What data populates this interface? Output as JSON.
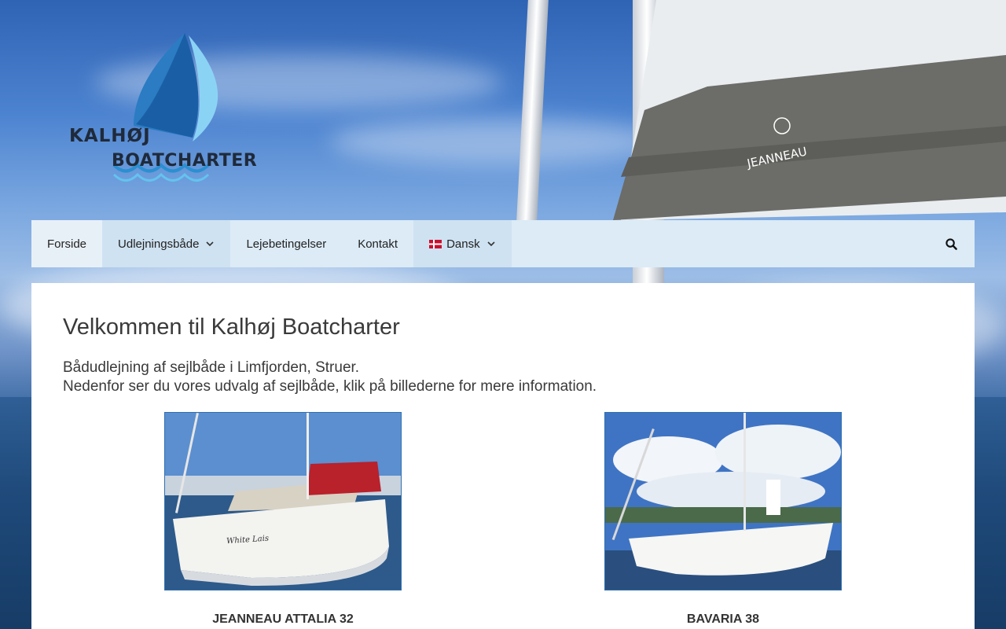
{
  "logo": {
    "line1": "KALHØJ",
    "line2": "BOATCHARTER"
  },
  "nav": {
    "items": [
      {
        "label": "Forside"
      },
      {
        "label": "Udlejningsbåde"
      },
      {
        "label": "Lejebetingelser"
      },
      {
        "label": "Kontakt"
      },
      {
        "label": "Dansk"
      }
    ]
  },
  "main": {
    "title": "Velkommen til Kalhøj Boatcharter",
    "intro_line1": "Bådudlejning af sejlbåde i Limfjorden, Struer.",
    "intro_line2": "Nedenfor ser du vores udvalg af sejlbåde, klik på billederne for mere information.",
    "boats": [
      {
        "name": "JEANNEAU ATTALIA 32",
        "hull_text": "White Lais"
      },
      {
        "name": "BAVARIA 38"
      }
    ]
  },
  "background": {
    "sail_brand": "JEANNEAU"
  },
  "colors": {
    "nav_bg": "#dcebf6",
    "accent": "#2f6fb0",
    "text": "#3a3a3a"
  }
}
